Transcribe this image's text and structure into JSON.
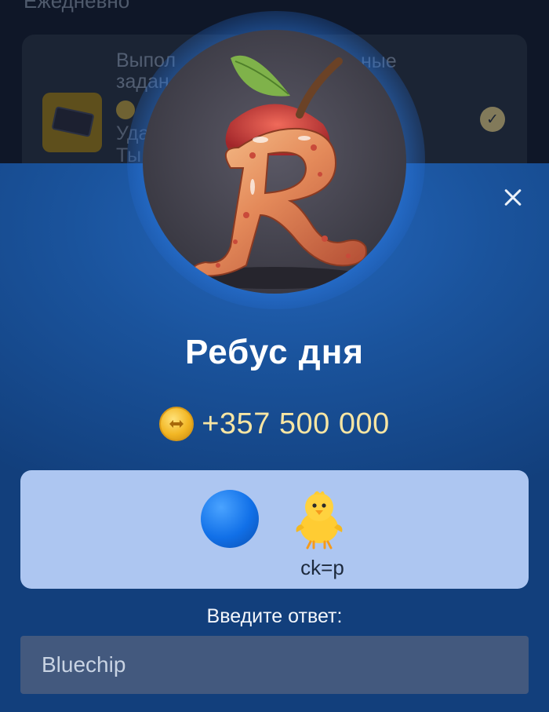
{
  "background": {
    "section_title": "Ежедневно",
    "card": {
      "title_line1": "Выпол",
      "title_line1_suffix": "ные",
      "title_line2": "задан",
      "line3": "Уда",
      "line4": "Ты",
      "completed": true
    }
  },
  "modal": {
    "title": "Ребус дня",
    "reward": "+357 500 000",
    "puzzle": {
      "items": [
        "blue-circle",
        "chick"
      ],
      "hint": "ck=p"
    },
    "answer_label": "Введите ответ:",
    "answer_value": "Bluechip"
  },
  "colors": {
    "sheet": "#1a539c",
    "puzzle_card": "#adc6f1",
    "input_bg": "#43597e",
    "reward_text": "#f7e5a3"
  },
  "icons": {
    "close": "close-icon",
    "coin": "coin-icon",
    "check": "check-icon"
  }
}
